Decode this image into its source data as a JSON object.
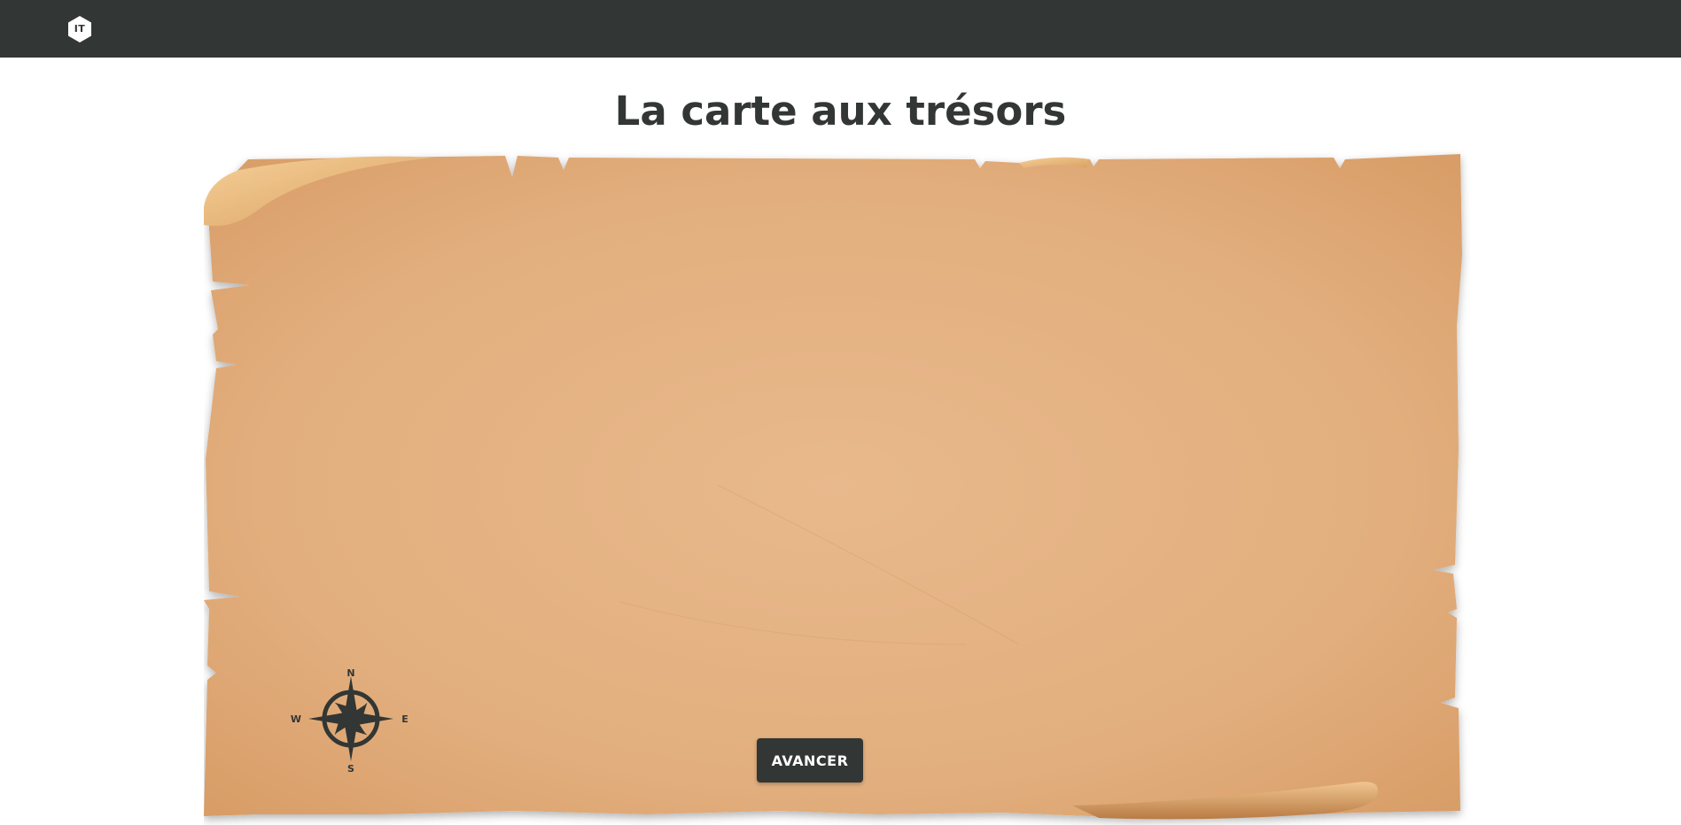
{
  "header": {
    "logo_text": "IT",
    "background": "#323634"
  },
  "page": {
    "title": "La carte aux trésors"
  },
  "map": {
    "background_texture": "parchment",
    "parchment_color": "#e0ad7c",
    "compass": {
      "north": "N",
      "south": "S",
      "east": "E",
      "west": "W",
      "icon": "compass-rose-icon"
    }
  },
  "controls": {
    "advance_label": "AVANCER"
  }
}
